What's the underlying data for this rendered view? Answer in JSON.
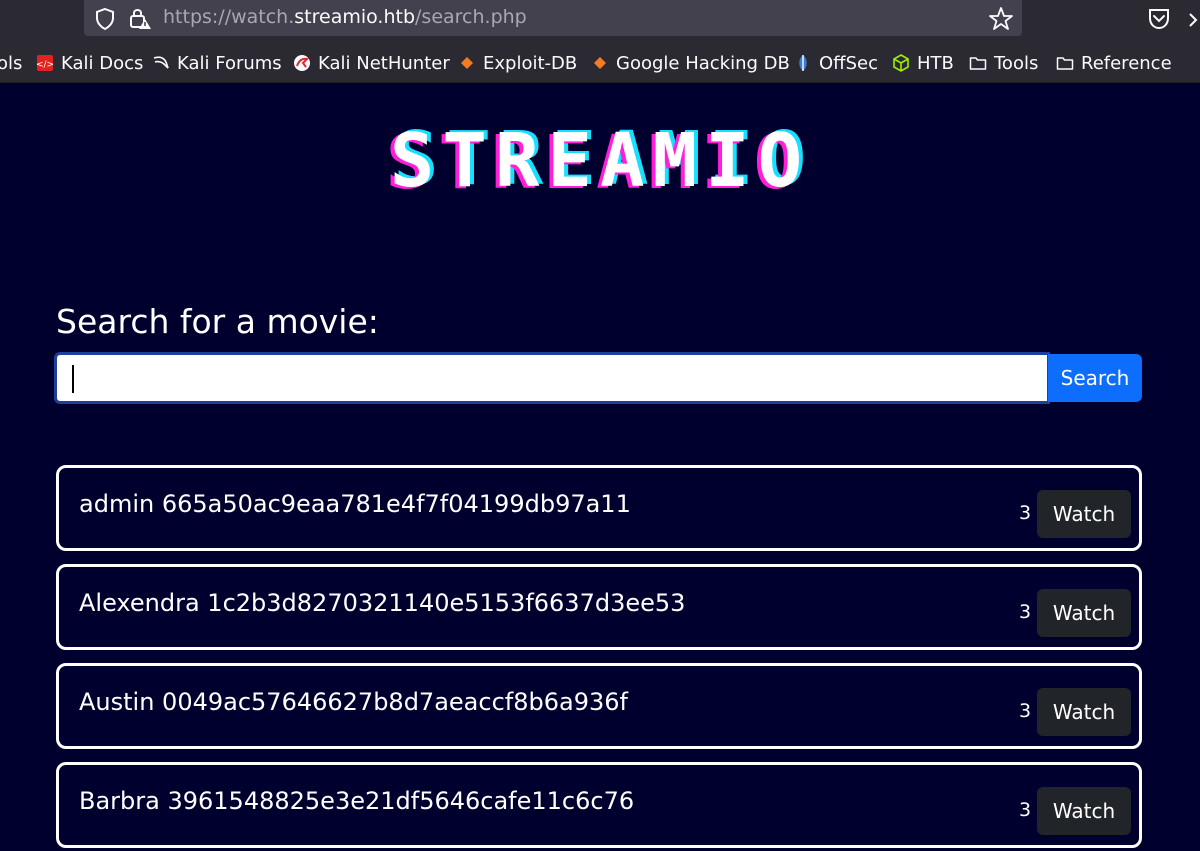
{
  "browser": {
    "url_prefix": "https://watch.",
    "url_host": "streamio.htb",
    "url_path": "/search.php",
    "bookmarks": [
      {
        "label": "ols"
      },
      {
        "label": "Kali Docs",
        "icon": "kali-docs-icon"
      },
      {
        "label": "Kali Forums",
        "icon": "kali-dragon-icon"
      },
      {
        "label": "Kali NetHunter",
        "icon": "nethunter-icon"
      },
      {
        "label": "Exploit-DB",
        "icon": "exploitdb-icon"
      },
      {
        "label": "Google Hacking DB",
        "icon": "ghdb-icon"
      },
      {
        "label": "OffSec",
        "icon": "offsec-icon"
      },
      {
        "label": "HTB",
        "icon": "htb-cube-icon"
      },
      {
        "label": "Tools",
        "icon": "folder-icon"
      },
      {
        "label": "Reference",
        "icon": "folder-icon"
      }
    ]
  },
  "page": {
    "logo": "STREAMIO",
    "search_label": "Search for a movie:",
    "search_value": "",
    "search_button": "Search"
  },
  "results": [
    {
      "title": "admin 665a50ac9eaa781e4f7f04199db97a11",
      "count": "3",
      "button": "Watch"
    },
    {
      "title": "Alexendra 1c2b3d8270321140e5153f6637d3ee53",
      "count": "3",
      "button": "Watch"
    },
    {
      "title": "Austin 0049ac57646627b8d7aeaccf8b6a936f",
      "count": "3",
      "button": "Watch"
    },
    {
      "title": "Barbra 3961548825e3e21df5646cafe11c6c76",
      "count": "3",
      "button": "Watch"
    }
  ],
  "colors": {
    "page_bg": "#00002e",
    "search_button": "#0d6efd",
    "watch_button": "#212529",
    "logo_pink": "#ff1fd8",
    "logo_cyan": "#16e0ff"
  }
}
